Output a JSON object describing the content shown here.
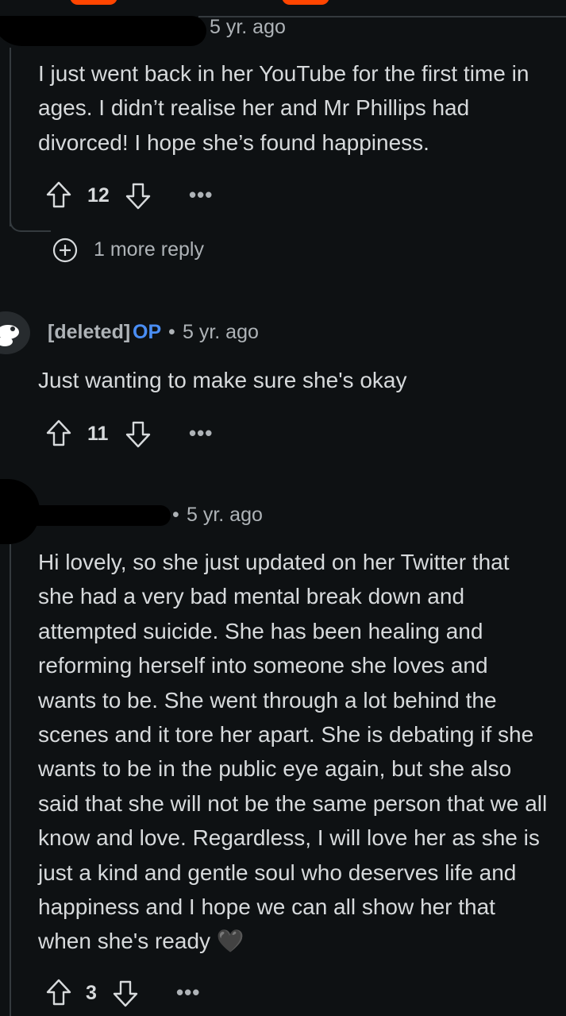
{
  "comment1": {
    "time": "5 yr. ago",
    "body": "I just went back in her YouTube for the first time in ages. I didn’t realise her and Mr Phillips had divorced! I hope she’s found happiness.",
    "votes": "12",
    "more_replies": "1 more reply"
  },
  "comment2": {
    "author": "[deleted]",
    "op_badge": "OP",
    "separator": "•",
    "time": "5 yr. ago",
    "body": "Just wanting to make sure she's okay",
    "votes": "11"
  },
  "comment3": {
    "separator": "•",
    "time": "5 yr. ago",
    "body": "Hi lovely, so she just updated on her Twitter that she had a very bad mental break down and attempted suicide. She has been healing and reforming herself into someone she loves and wants to be. She went through a lot behind the scenes and it tore her apart. She is debating if she wants to be in the public eye again, but she also said that she will not be the same person that we all know and love. Regardless, I will love her as she is just a kind and gentle soul who deserves life and happiness and I hope we can all show her that when she's ready",
    "emoji": "🖤",
    "votes": "3"
  },
  "more_label": "•••",
  "colors": {
    "background": "#0e1113",
    "op_blue": "#4a8ef5",
    "accent_orange": "#ff4500"
  }
}
